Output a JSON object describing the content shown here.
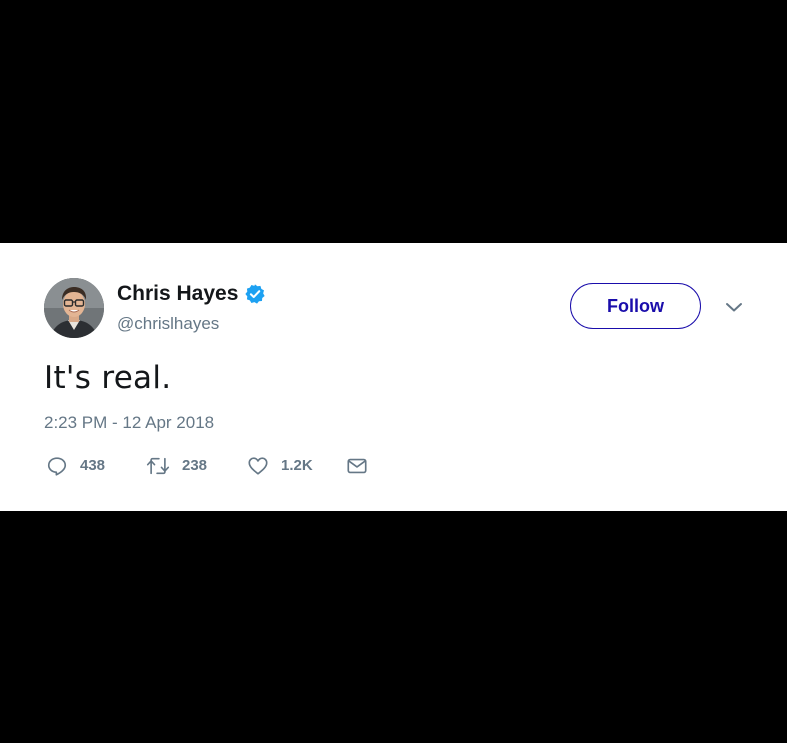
{
  "tweet": {
    "author": {
      "display_name": "Chris Hayes",
      "handle": "@chrislhayes",
      "verified": true
    },
    "follow_label": "Follow",
    "text": "It's real.",
    "timestamp": "2:23 PM - 12 Apr 2018",
    "stats": {
      "replies": "438",
      "retweets": "238",
      "likes": "1.2K"
    }
  },
  "icons": {
    "verified": "verified-badge-icon",
    "menu": "chevron-down-icon",
    "reply": "reply-icon",
    "retweet": "retweet-icon",
    "like": "heart-icon",
    "dm": "envelope-icon"
  },
  "colors": {
    "background_band": "#000000",
    "card_background": "#ffffff",
    "name_text": "#14171a",
    "muted_text": "#657786",
    "follow_accent": "#1a0dab",
    "verified_blue": "#1da1f2"
  }
}
